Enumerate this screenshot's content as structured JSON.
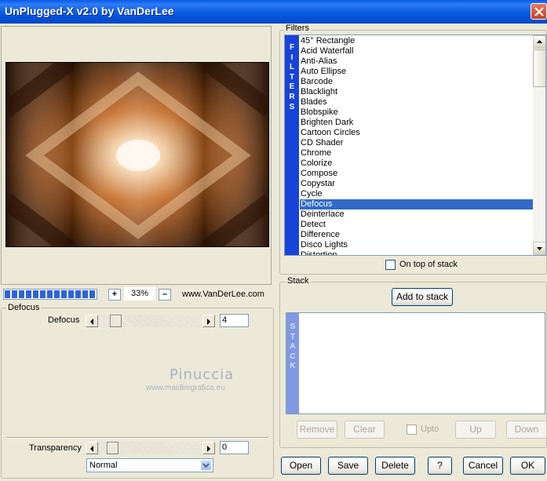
{
  "window": {
    "title": "UnPlugged-X v2.0 by VanDerLee"
  },
  "preview": {
    "zoom": "33%",
    "zoom_in": "+",
    "zoom_out": "–",
    "site": "www.VanDerLee.com",
    "progress_blocks": 13
  },
  "effect": {
    "group_label": "Defocus",
    "param_label": "Defocus",
    "param_value": "4",
    "param_fraction": 0.03
  },
  "watermark": {
    "line1": "Pinuccia",
    "line2": "www.maidiregrafica.eu"
  },
  "transparency": {
    "label": "Transparency",
    "value": "0",
    "fraction": 0.0
  },
  "blend": {
    "selected": "Normal"
  },
  "filters": {
    "group_label": "Filters",
    "side_letters": [
      "F",
      "I",
      "L",
      "T",
      "E",
      "R",
      "S"
    ],
    "selected": "Defocus",
    "items": [
      "45° Rectangle",
      "Acid Waterfall",
      "Anti-Alias",
      "Auto Ellipse",
      "Barcode",
      "Blacklight",
      "Blades",
      "Blobspike",
      "Brighten Dark",
      "Cartoon Circles",
      "CD Shader",
      "Chrome",
      "Colorize",
      "Compose",
      "Copystar",
      "Cycle",
      "Defocus",
      "Deinterlace",
      "Detect",
      "Difference",
      "Disco Lights",
      "Distortion"
    ],
    "on_top_label": "On top of stack"
  },
  "stack": {
    "group_label": "Stack",
    "add_label": "Add to stack",
    "side_letters": [
      "S",
      "T",
      "A",
      "C",
      "K"
    ],
    "remove_label": "Remove",
    "clear_label": "Clear",
    "upto_label": "Upto",
    "up_label": "Up",
    "down_label": "Down"
  },
  "footer": {
    "open": "Open",
    "save": "Save",
    "delete": "Delete",
    "help": "?",
    "cancel": "Cancel",
    "ok": "OK"
  },
  "colors": {
    "titlebar": "#0a5ae0",
    "selection": "#316ac5",
    "filters_side": "#1843d8",
    "stack_side": "#8099e2"
  }
}
